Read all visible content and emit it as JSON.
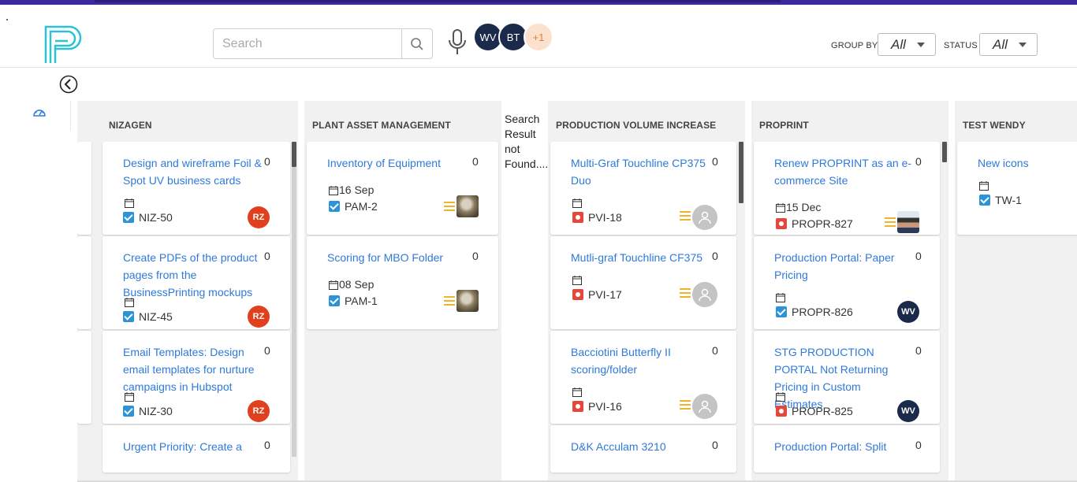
{
  "header": {
    "search_placeholder": "Search",
    "avatars": [
      "WV",
      "BT",
      "+1"
    ],
    "group_by_label": "GROUP BY",
    "group_by_value": "All",
    "status_label": "STATUS",
    "status_value": "All"
  },
  "colors": {
    "accent_blue": "#2f7ad8",
    "brand_purple": "#3b2a9e",
    "avatar_navy": "#1b2a4a",
    "avatar_red": "#e0401d",
    "bug_red": "#e5483b",
    "task_blue": "#2c93d8",
    "priority_yellow": "#f0b429"
  },
  "board": {
    "empty_search_message": "Search Result not Found....",
    "columns": [
      {
        "title": "NIZAGEN",
        "cards": [
          {
            "title": "Design and wireframe Foil & Spot UV business cards",
            "count": "0",
            "date": "",
            "key": "NIZ-50",
            "type": "task",
            "assignee": "RZ"
          },
          {
            "title": "Create PDFs of the product pages from the BusinessPrinting mockups",
            "count": "0",
            "date": "",
            "key": "NIZ-45",
            "type": "task",
            "assignee": "RZ"
          },
          {
            "title": "Email Templates: Design email templates for nurture campaigns in Hubspot",
            "count": "0",
            "date": "",
            "key": "NIZ-30",
            "type": "task",
            "assignee": "RZ"
          },
          {
            "title": "Urgent Priority: Create a",
            "count": "0"
          }
        ]
      },
      {
        "title": "PLANT ASSET MANAGEMENT",
        "cards": [
          {
            "title": "Inventory of Equipment",
            "count": "0",
            "date": "16 Sep",
            "key": "PAM-2",
            "type": "task"
          },
          {
            "title": "Scoring for MBO Folder",
            "count": "0",
            "date": "08 Sep",
            "key": "PAM-1",
            "type": "task"
          }
        ]
      },
      {
        "title": "PRODUCTION VOLUME INCREASE",
        "cards": [
          {
            "title": "Multi-Graf Touchline CP375 Duo",
            "count": "0",
            "date": "",
            "key": "PVI-18",
            "type": "bug"
          },
          {
            "title": "Mutli-graf Touchline CF375",
            "count": "0",
            "date": "",
            "key": "PVI-17",
            "type": "bug"
          },
          {
            "title": "Bacciotini Butterfly II scoring/folder",
            "count": "0",
            "date": "",
            "key": "PVI-16",
            "type": "bug"
          },
          {
            "title": "D&K Acculam 3210",
            "count": "0"
          }
        ]
      },
      {
        "title": "PROPRINT",
        "cards": [
          {
            "title": "Renew PROPRINT as an e-commerce Site",
            "count": "0",
            "date": "15 Dec",
            "key": "PROPR-827",
            "type": "bug"
          },
          {
            "title": "Production Portal: Paper Pricing",
            "count": "0",
            "date": "",
            "key": "PROPR-826",
            "type": "task",
            "assignee": "WV"
          },
          {
            "title": "STG PRODUCTION PORTAL Not Returning Pricing in Custom Estimates",
            "count": "0",
            "date": "",
            "key": "PROPR-825",
            "type": "bug",
            "assignee": "WV"
          },
          {
            "title": "Production Portal: Split",
            "count": "0"
          }
        ]
      },
      {
        "title": "TEST WENDY",
        "cards": [
          {
            "title": "New icons",
            "count": "",
            "date": "",
            "key": "TW-1",
            "type": "task"
          }
        ]
      }
    ]
  }
}
